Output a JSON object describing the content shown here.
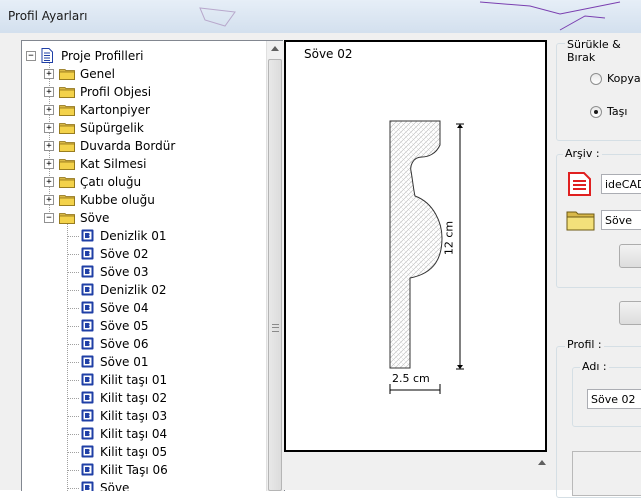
{
  "window": {
    "title": "Profil Ayarları"
  },
  "tree": {
    "root": "Proje Profilleri",
    "folders": [
      {
        "label": "Genel",
        "expanded": false
      },
      {
        "label": "Profil Objesi",
        "expanded": false
      },
      {
        "label": "Kartonpiyer",
        "expanded": false
      },
      {
        "label": "Süpürgelik",
        "expanded": false
      },
      {
        "label": "Duvarda Bordür",
        "expanded": false
      },
      {
        "label": "Kat Silmesi",
        "expanded": false
      },
      {
        "label": "Çatı oluğu",
        "expanded": false
      },
      {
        "label": "Kubbe oluğu",
        "expanded": false
      },
      {
        "label": "Söve",
        "expanded": true
      }
    ],
    "children": [
      "Denizlik 01",
      "Söve 02",
      "Söve 03",
      "Denizlik 02",
      "Söve 04",
      "Söve 05",
      "Söve 06",
      "Söve 01",
      "Kilit taşı 01",
      "Kilit taşı 02",
      "Kilit taşı 03",
      "Kilit taşı 04",
      "Kilit taşı 05",
      "Kilit Taşı 06",
      "Söve"
    ]
  },
  "preview": {
    "title": "Söve 02",
    "height_dim": "12 cm",
    "width_dim": "2.5 cm"
  },
  "drag_drop": {
    "label": "Sürükle & Bırak",
    "options": [
      {
        "label": "Kopya",
        "checked": false
      },
      {
        "label": "Taşı",
        "checked": true
      }
    ]
  },
  "archive": {
    "label": "Arşiv :",
    "file_value": "ideCAD",
    "folder_value": "Söve"
  },
  "profile": {
    "label": "Profil :",
    "name_label": "Adı :",
    "name_value": "Söve 02"
  },
  "colors": {
    "selection_border": "#000000",
    "group_border": "#d5dfe5",
    "icon_blue": "#1f3fa6",
    "folder_yellow": "#f3d24b",
    "pdf_red": "#e02020"
  }
}
